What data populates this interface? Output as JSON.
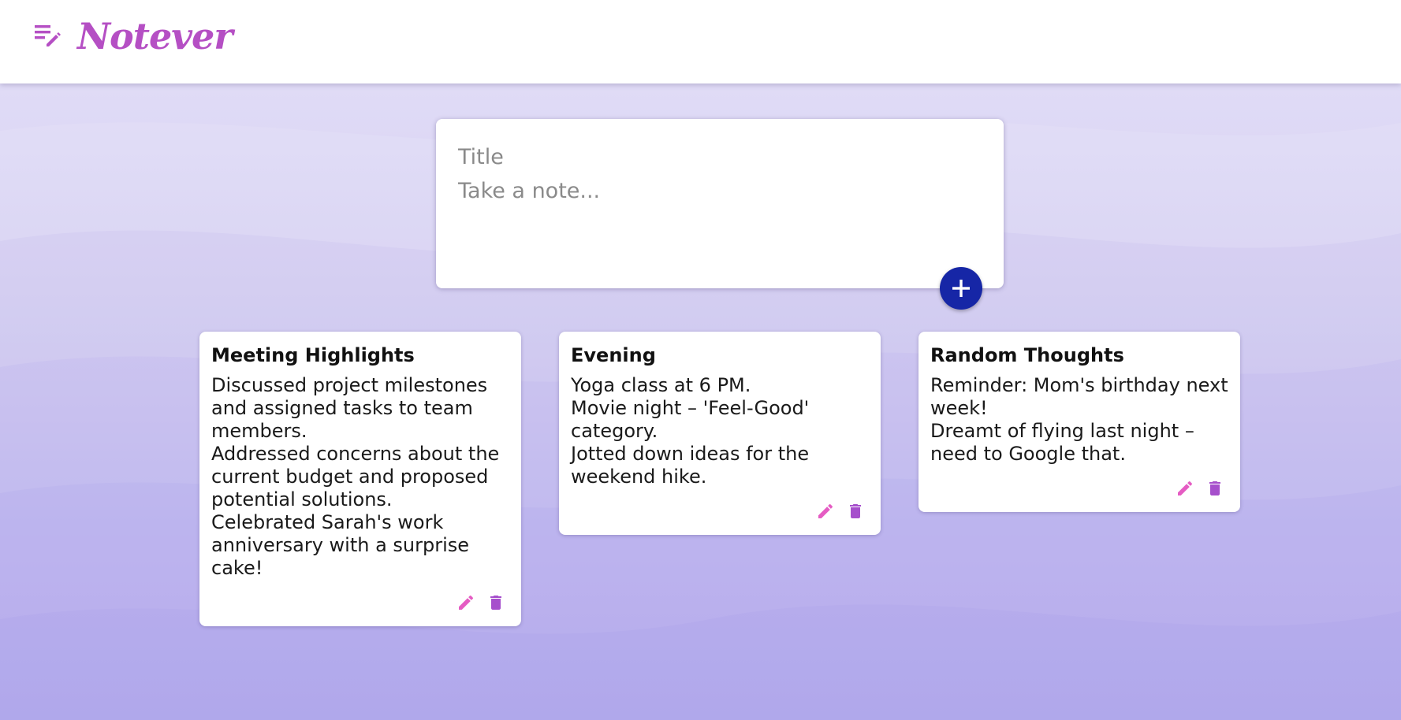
{
  "app": {
    "name": "Notever",
    "logo_icon": "notes-edit-icon",
    "brand_color": "#b54fc4"
  },
  "composer": {
    "title_placeholder": "Title",
    "note_placeholder": "Take a note...",
    "add_icon": "plus-icon",
    "add_button_color": "#1626a6"
  },
  "notes": [
    {
      "title": "Meeting Highlights",
      "lines": [
        "Discussed project milestones and assigned tasks to team members.",
        "Addressed concerns about the current budget and proposed potential solutions.",
        "Celebrated Sarah's work anniversary with a surprise cake!"
      ],
      "edit_icon": "pencil-icon",
      "delete_icon": "trash-icon"
    },
    {
      "title": "Evening",
      "lines": [
        "Yoga class at 6 PM.",
        "Movie night – 'Feel-Good' category.",
        "Jotted down ideas for the weekend hike."
      ],
      "edit_icon": "pencil-icon",
      "delete_icon": "trash-icon"
    },
    {
      "title": "Random Thoughts",
      "lines": [
        "Reminder: Mom's birthday next week!",
        "Dreamt of flying last night – need to Google that."
      ],
      "edit_icon": "pencil-icon",
      "delete_icon": "trash-icon"
    }
  ],
  "colors": {
    "edit_icon": "#e55cc3",
    "delete_icon": "#a64fcc"
  }
}
